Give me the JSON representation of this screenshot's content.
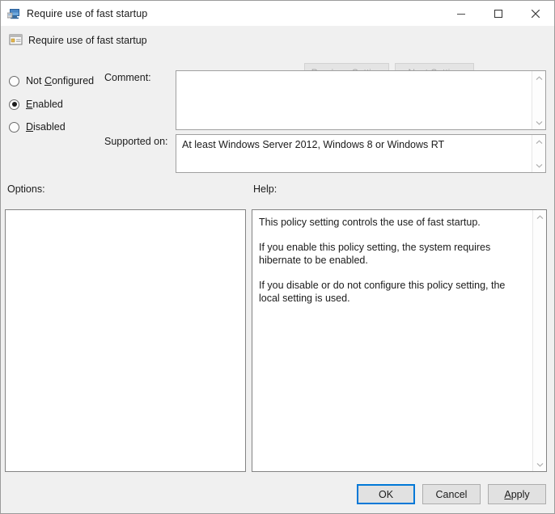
{
  "window": {
    "title": "Require use of fast startup",
    "icon": "policy-computer-icon",
    "minimize_label": "—",
    "maximize_label": "☐",
    "close_label": "✕"
  },
  "header": {
    "title": "Require use of fast startup",
    "icon": "policy-setting-icon",
    "previous_setting_label": "Previous Setting",
    "previous_setting_accel": "P",
    "next_setting_label": "Next Setting",
    "next_setting_accel": "N",
    "buttons_disabled": true
  },
  "state_options": {
    "selected": "Enabled",
    "items": [
      {
        "label": "Not Configured",
        "accel": "C",
        "before": "Not ",
        "after": "onfigured",
        "selected": false
      },
      {
        "label": "Enabled",
        "accel": "E",
        "before": "",
        "after": "nabled",
        "selected": true
      },
      {
        "label": "Disabled",
        "accel": "D",
        "before": "",
        "after": "isabled",
        "selected": false
      }
    ]
  },
  "comment": {
    "label": "Comment:",
    "value": "",
    "placeholder": ""
  },
  "supported_on": {
    "label": "Supported on:",
    "value": "At least Windows Server 2012, Windows 8 or Windows RT"
  },
  "options": {
    "label": "Options:",
    "content": ""
  },
  "help": {
    "label": "Help:",
    "paragraphs": [
      "This policy setting controls the use of fast startup.",
      "If you enable this policy setting, the system requires hibernate to be enabled.",
      "If you disable or do not configure this policy setting, the local setting is used."
    ]
  },
  "footer": {
    "ok_label": "OK",
    "cancel_label": "Cancel",
    "apply_label": "Apply",
    "apply_accel": "A",
    "default_button": "OK"
  },
  "colors": {
    "dialog_background": "#f0f0f0",
    "field_background": "#ffffff",
    "text": "#1b1b1b",
    "disabled_text": "#a7a7a7",
    "focus_accent": "#0078d7",
    "border": "#a0a0a0"
  },
  "scrollbars": {
    "up_arrow": "∧",
    "down_arrow": "∨"
  }
}
